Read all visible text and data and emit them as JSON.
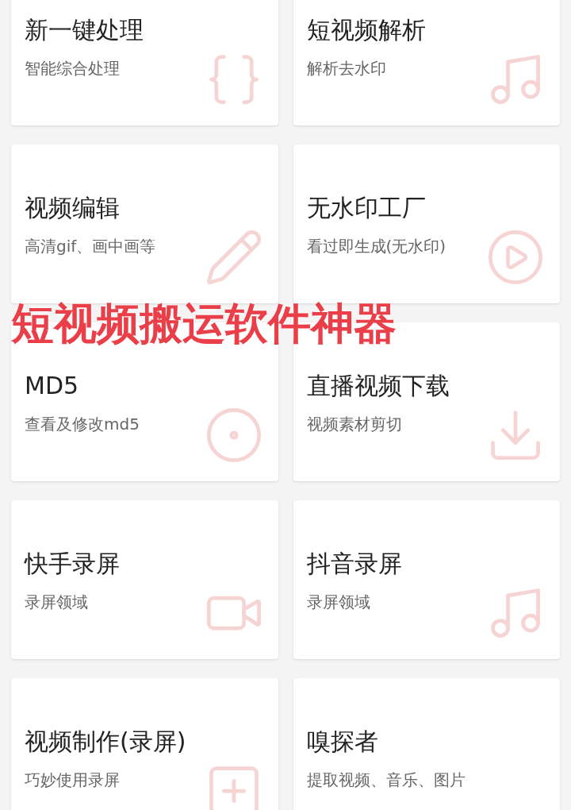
{
  "cards": [
    {
      "title": "新一键处理",
      "subtitle": "智能综合处理"
    },
    {
      "title": "短视频解析",
      "subtitle": "解析去水印"
    },
    {
      "title": "视频编辑",
      "subtitle": "高清gif、画中画等"
    },
    {
      "title": "无水印工厂",
      "subtitle": "看过即生成(无水印)"
    },
    {
      "title": "MD5",
      "subtitle": "查看及修改md5"
    },
    {
      "title": "直播视频下载",
      "subtitle": "视频素材剪切"
    },
    {
      "title": "快手录屏",
      "subtitle": "录屏领域"
    },
    {
      "title": "抖音录屏",
      "subtitle": "录屏领域"
    },
    {
      "title": "视频制作(录屏)",
      "subtitle": "巧妙使用录屏"
    },
    {
      "title": "嗅探者",
      "subtitle": "提取视频、音乐、图片"
    }
  ],
  "overlay_caption": "短视频搬运软件神器"
}
